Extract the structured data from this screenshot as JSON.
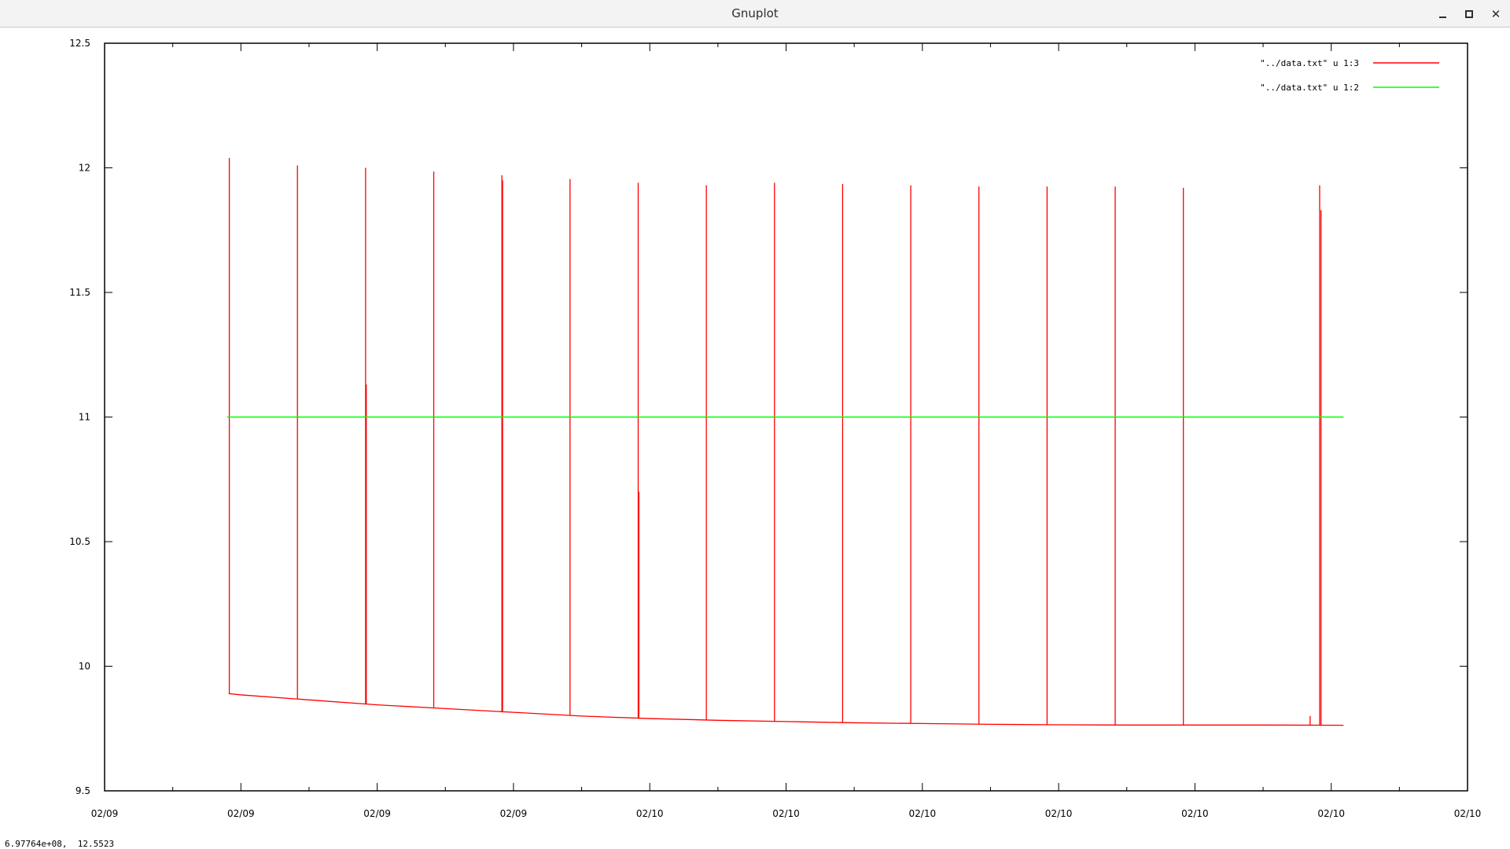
{
  "window": {
    "title": "Gnuplot",
    "minimize_icon": "minimize-icon",
    "maximize_icon": "maximize-icon",
    "close_icon": "close-icon",
    "close_glyph": "✕"
  },
  "status_text": "6.97764e+08,  12.5523",
  "chart_data": {
    "type": "line",
    "xlabel": "",
    "ylabel": "",
    "xlim": [
      0,
      20
    ],
    "ylim": [
      9.5,
      12.5
    ],
    "x_ticks": [
      "02/09",
      "02/09",
      "02/09",
      "02/09",
      "02/10",
      "02/10",
      "02/10",
      "02/10",
      "02/10",
      "02/10",
      "02/10"
    ],
    "y_ticks": [
      12.5,
      12,
      11.5,
      11,
      10.5,
      10,
      9.5
    ],
    "y_tick_labels": [
      "12.5",
      "12",
      "11.5",
      "11",
      "10.5",
      "10",
      "9.5"
    ],
    "grid": false,
    "legend_position": "top-right",
    "series": [
      {
        "name": "\"../data.txt\" u 1:3",
        "color": "#ff0000",
        "baseline": {
          "x": [
            1.82,
            2.0,
            3.0,
            4.0,
            5.0,
            6.0,
            7.0,
            8.0,
            9.0,
            10.0,
            11.0,
            12.0,
            13.0,
            14.0,
            15.0,
            16.0,
            17.0,
            18.18
          ],
          "y": [
            9.89,
            9.885,
            9.865,
            9.845,
            9.83,
            9.815,
            9.8,
            9.79,
            9.783,
            9.778,
            9.773,
            9.77,
            9.767,
            9.765,
            9.764,
            9.764,
            9.764,
            9.763
          ]
        },
        "spikes": [
          {
            "x": 1.83,
            "y": 12.04
          },
          {
            "x": 2.83,
            "y": 12.01
          },
          {
            "x": 3.83,
            "y": 12.0
          },
          {
            "x": 3.84,
            "y": 11.13
          },
          {
            "x": 4.83,
            "y": 11.985
          },
          {
            "x": 5.83,
            "y": 11.97
          },
          {
            "x": 5.84,
            "y": 11.95
          },
          {
            "x": 6.83,
            "y": 11.955
          },
          {
            "x": 7.83,
            "y": 11.94
          },
          {
            "x": 7.84,
            "y": 10.7
          },
          {
            "x": 8.83,
            "y": 11.93
          },
          {
            "x": 9.83,
            "y": 11.94
          },
          {
            "x": 10.83,
            "y": 11.935
          },
          {
            "x": 11.83,
            "y": 11.93
          },
          {
            "x": 12.83,
            "y": 11.925
          },
          {
            "x": 13.83,
            "y": 11.925
          },
          {
            "x": 14.83,
            "y": 11.925
          },
          {
            "x": 15.83,
            "y": 11.92
          },
          {
            "x": 17.69,
            "y": 9.8
          },
          {
            "x": 17.83,
            "y": 11.93
          },
          {
            "x": 17.85,
            "y": 11.83
          }
        ]
      },
      {
        "name": "\"../data.txt\" u 1:2",
        "color": "#00ff00",
        "x": [
          1.8,
          18.18
        ],
        "y": [
          11.0,
          11.0
        ]
      }
    ]
  }
}
